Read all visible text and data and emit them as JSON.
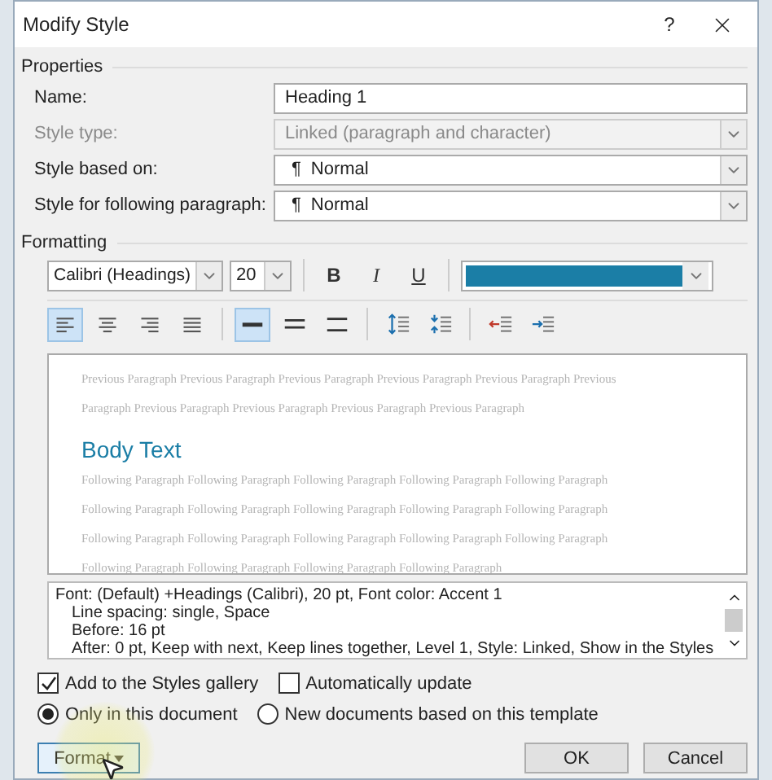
{
  "window": {
    "title": "Modify Style",
    "help": "?"
  },
  "properties": {
    "heading": "Properties",
    "rows": [
      {
        "label": "Name:",
        "kind": "text",
        "value": "Heading 1",
        "disabled": false
      },
      {
        "label": "Style type:",
        "kind": "dropdown",
        "value": "Linked (paragraph and character)",
        "disabled": true
      },
      {
        "label": "Style based on:",
        "kind": "dropdown",
        "mark": "¶",
        "value": "Normal",
        "disabled": false
      },
      {
        "label": "Style for following paragraph:",
        "kind": "dropdown",
        "mark": "¶",
        "value": "Normal",
        "disabled": false
      }
    ]
  },
  "formatting": {
    "heading": "Formatting",
    "font": "Calibri (Headings)",
    "size": "20",
    "styles": [
      {
        "label": "B",
        "kind": "bold",
        "selected": false
      },
      {
        "label": "I",
        "kind": "italic",
        "selected": false
      },
      {
        "label": "U",
        "kind": "underline",
        "selected": false
      }
    ],
    "font_color": {
      "color": "#1b7ea6"
    },
    "alignment": [
      {
        "kind": "left",
        "selected": true
      },
      {
        "kind": "center",
        "selected": false
      },
      {
        "kind": "right",
        "selected": false
      },
      {
        "kind": "justify",
        "selected": false
      }
    ],
    "spacing": [
      {
        "kind": "single",
        "selected": true
      },
      {
        "kind": "onehalf",
        "selected": false
      },
      {
        "kind": "double",
        "selected": false
      }
    ],
    "paragraph": [
      {
        "kind": "space-before"
      },
      {
        "kind": "space-after"
      },
      {
        "kind": "outdent"
      },
      {
        "kind": "indent"
      }
    ]
  },
  "preview": {
    "previous": [
      "Previous Paragraph Previous Paragraph Previous Paragraph Previous Paragraph Previous Paragraph Previous",
      "Paragraph Previous Paragraph Previous Paragraph Previous Paragraph Previous Paragraph"
    ],
    "sample": "Body Text",
    "following": [
      "Following Paragraph Following Paragraph Following Paragraph Following Paragraph Following Paragraph",
      "Following Paragraph Following Paragraph Following Paragraph Following Paragraph Following Paragraph",
      "Following Paragraph Following Paragraph Following Paragraph Following Paragraph Following Paragraph",
      "Following Paragraph Following Paragraph Following Paragraph Following Paragraph"
    ]
  },
  "description": [
    "Font: (Default) +Headings (Calibri), 20 pt, Font color: Accent 1",
    "Line spacing:  single, Space",
    "Before:  16 pt",
    "After:  0 pt, Keep with next, Keep lines together, Level 1, Style: Linked, Show in the Styles"
  ],
  "options": [
    {
      "label": "Add to the Styles gallery",
      "checked": true
    },
    {
      "label": "Automatically update",
      "checked": false
    }
  ],
  "scope": [
    {
      "label": "Only in this document",
      "selected": true
    },
    {
      "label": "New documents based on this template",
      "selected": false
    }
  ],
  "buttons": [
    {
      "label": "Format",
      "kind": "menu",
      "focused": true
    },
    {
      "label": "OK",
      "kind": "plain",
      "focused": false
    },
    {
      "label": "Cancel",
      "kind": "plain",
      "focused": false
    }
  ]
}
